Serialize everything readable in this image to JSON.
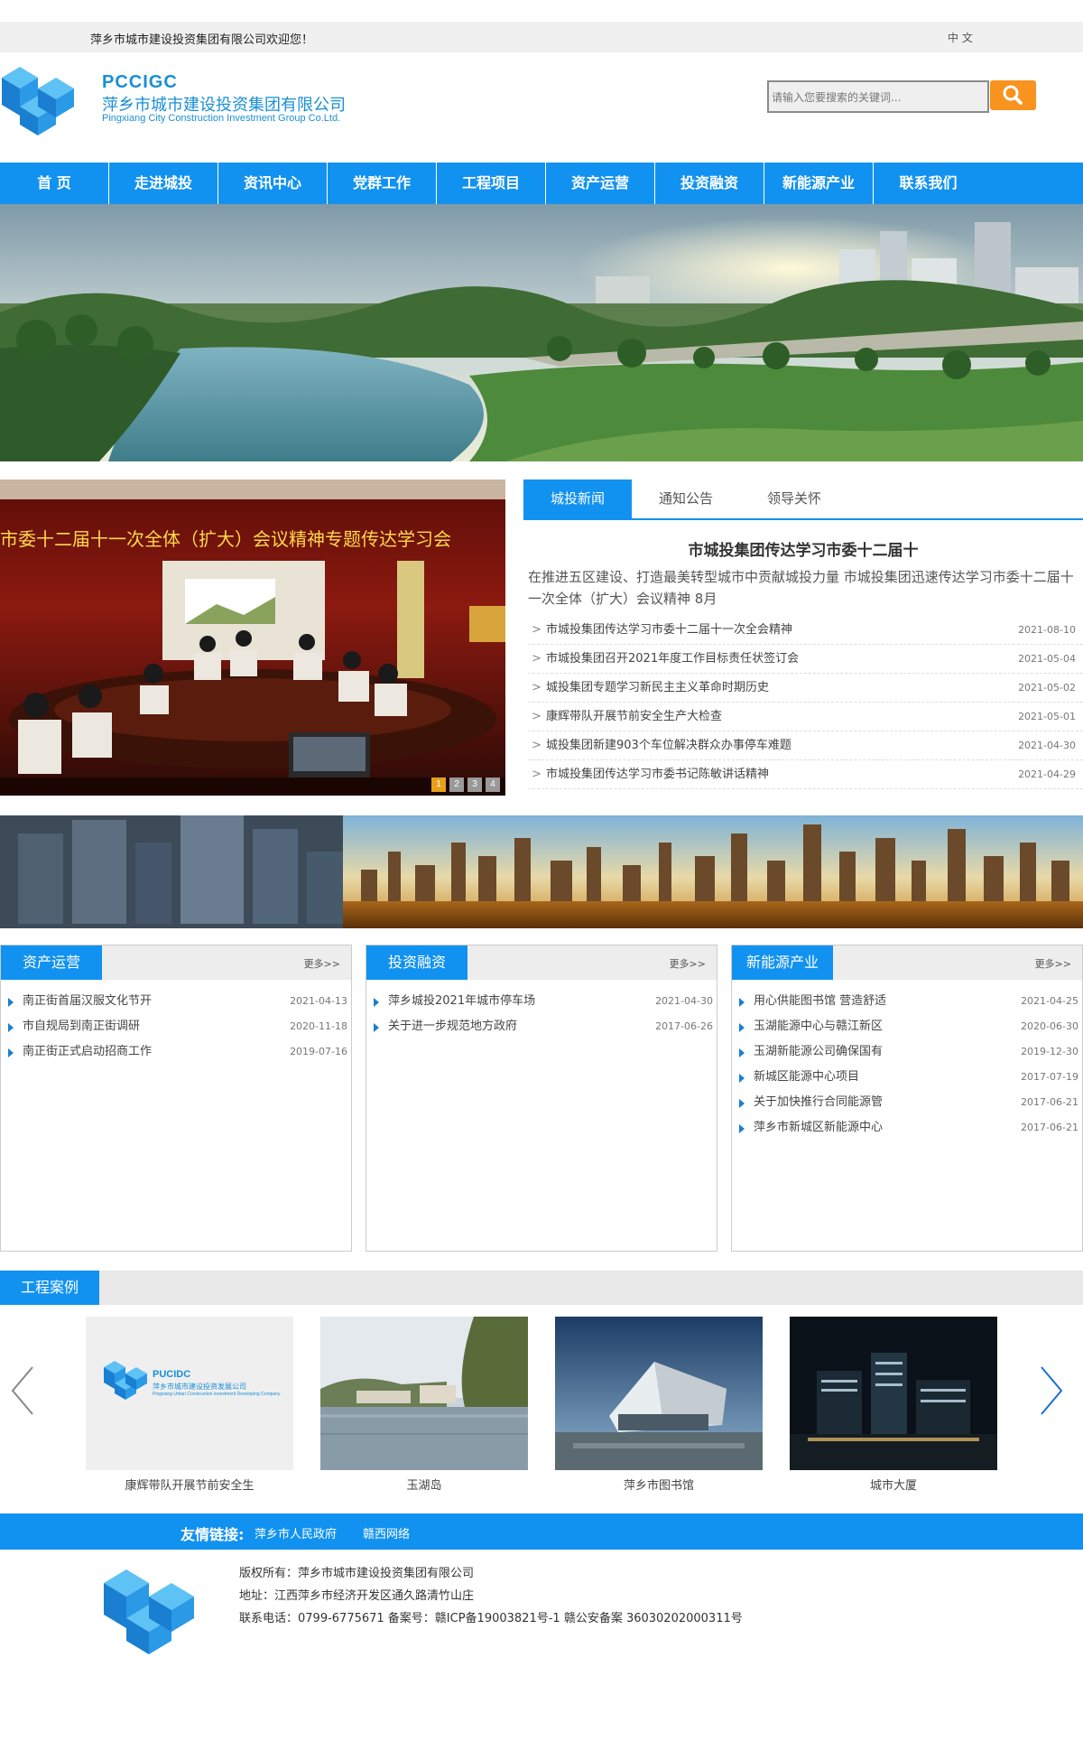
{
  "topbar": {
    "welcome": "萍乡市城市建设投资集团有限公司欢迎您！",
    "lang": "中 文"
  },
  "header": {
    "logo_short": "PCCIGC",
    "logo_cn": "萍乡市城市建设投资集团有限公司",
    "logo_en": "Pingxiang City Construction Investment Group Co.Ltd.",
    "search_placeholder": "请输入您要搜索的关键词...",
    "search_icon": "search-icon"
  },
  "nav": [
    "首 页",
    "走进城投",
    "资讯中心",
    "党群工作",
    "工程项目",
    "资产运营",
    "投资融资",
    "新能源产业",
    "联系我们"
  ],
  "news_photo": {
    "caption": "市委十二届十一次全体（扩大）会议精神专题传达学习会",
    "dots": [
      "1",
      "2",
      "3",
      "4"
    ]
  },
  "news_panel": {
    "tabs": [
      "城投新闻",
      "通知公告",
      "领导关怀"
    ],
    "headline": "市城投集团传达学习市委十二届十",
    "summary": "在推进五区建设、打造最美转型城市中贡献城投力量 市城投集团迅速传达学习市委十二届十一次全体（扩大）会议精神 8月",
    "items": [
      {
        "title": "市城投集团传达学习市委十二届十一次全会精神",
        "date": "2021-08-10"
      },
      {
        "title": "市城投集团召开2021年度工作目标责任状签订会",
        "date": "2021-05-04"
      },
      {
        "title": "城投集团专题学习新民主主义革命时期历史",
        "date": "2021-05-02"
      },
      {
        "title": "康辉带队开展节前安全生产大检查",
        "date": "2021-05-01"
      },
      {
        "title": "城投集团新建903个车位解决群众办事停车难题",
        "date": "2021-04-30"
      },
      {
        "title": "市城投集团传达学习市委书记陈敏讲话精神",
        "date": "2021-04-29"
      }
    ]
  },
  "boxes": [
    {
      "title": "资产运营",
      "more": "更多>>",
      "items": [
        {
          "title": "南正街首届汉服文化节开",
          "date": "2021-04-13"
        },
        {
          "title": "市自规局到南正街调研",
          "date": "2020-11-18"
        },
        {
          "title": "南正街正式启动招商工作",
          "date": "2019-07-16"
        }
      ]
    },
    {
      "title": "投资融资",
      "more": "更多>>",
      "items": [
        {
          "title": "萍乡城投2021年城市停车场",
          "date": "2021-04-30"
        },
        {
          "title": "关于进一步规范地方政府",
          "date": "2017-06-26"
        }
      ]
    },
    {
      "title": "新能源产业",
      "more": "更多>>",
      "items": [
        {
          "title": "用心供能图书馆 营造舒适",
          "date": "2021-04-25"
        },
        {
          "title": "玉湖能源中心与赣江新区",
          "date": "2020-06-30"
        },
        {
          "title": "玉湖新能源公司确保国有",
          "date": "2019-12-30"
        },
        {
          "title": "新城区能源中心项目",
          "date": "2017-07-19"
        },
        {
          "title": "关于加快推行合同能源管",
          "date": "2017-06-21"
        },
        {
          "title": "萍乡市新城区新能源中心",
          "date": "2017-06-21"
        }
      ]
    }
  ],
  "cases": {
    "title": "工程案例",
    "items": [
      {
        "label": "康辉带队开展节前安全生",
        "logo_short": "PUCIDC",
        "logo_cn": "萍乡市城市建设投资发展公司",
        "logo_en": "Pingxiang Urban Construction Investment Developing Company"
      },
      {
        "label": "玉湖岛"
      },
      {
        "label": "萍乡市图书馆"
      },
      {
        "label": "城市大厦"
      }
    ]
  },
  "friend": {
    "label": "友情链接:",
    "links": [
      "萍乡市人民政府",
      "赣西网络"
    ]
  },
  "footer": {
    "copyright": "版权所有：萍乡市城市建设投资集团有限公司",
    "address": "地址：江西萍乡市经济开发区通久路清竹山庄",
    "contact": "联系电话：0799-6775671 备案号：赣ICP备19003821号-1 赣公安备案 36030202000311号"
  },
  "colors": {
    "primary": "#1292f0",
    "search_button": "#f7931e",
    "logo": "#1a8fd6"
  }
}
